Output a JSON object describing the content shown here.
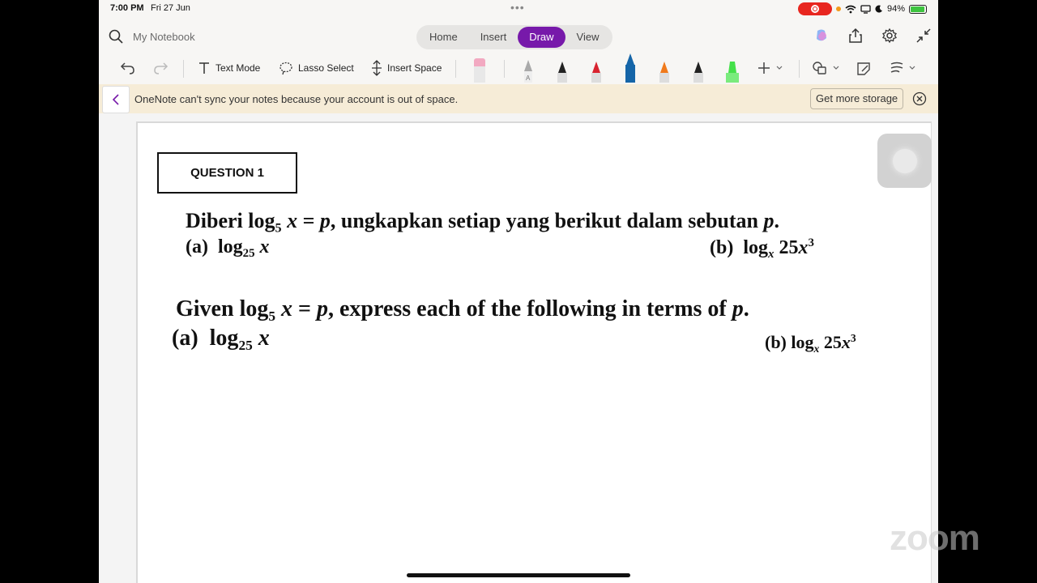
{
  "status": {
    "time": "7:00 PM",
    "date": "Fri 27 Jun",
    "battery": "94%",
    "battery_level": 0.94
  },
  "topbar": {
    "notebook": "My Notebook",
    "tabs": [
      {
        "label": "Home",
        "active": false
      },
      {
        "label": "Insert",
        "active": false
      },
      {
        "label": "Draw",
        "active": true
      },
      {
        "label": "View",
        "active": false
      }
    ]
  },
  "toolbar": {
    "text_mode": "Text Mode",
    "lasso_select": "Lasso Select",
    "insert_space": "Insert Space",
    "pens": [
      {
        "name": "pink-eraser",
        "color": "#f2a9c1"
      },
      {
        "name": "pencil-gray",
        "color": "#a9a9a9"
      },
      {
        "name": "pen-black",
        "color": "#222222"
      },
      {
        "name": "pen-red",
        "color": "#d8232f"
      },
      {
        "name": "pen-blue",
        "color": "#1565a8"
      },
      {
        "name": "pen-orange",
        "color": "#f07a1c"
      },
      {
        "name": "pen-black-2",
        "color": "#222222"
      },
      {
        "name": "highlighter-green",
        "color": "#45e04a"
      }
    ]
  },
  "banner": {
    "message": "OneNote can't sync your notes because your account is out of space.",
    "action": "Get more storage"
  },
  "page": {
    "question_label": "QUESTION 1",
    "malay": {
      "intro": "Diberi",
      "rest": ", ungkapkan setiap yang berikut dalam sebutan"
    },
    "english": {
      "intro": "Given",
      "rest": ", express each of the following in terms of"
    },
    "part_a": "(a)",
    "part_b": "(b)"
  },
  "watermark": "zoom",
  "colors": {
    "accent": "#7719aa",
    "banner_bg": "#f6ecd7",
    "record": "#e8261f"
  }
}
